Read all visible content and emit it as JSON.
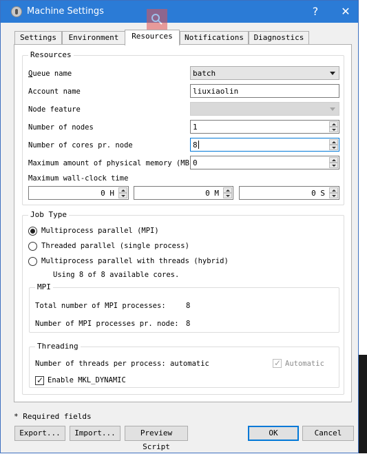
{
  "window": {
    "title": "Machine Settings",
    "help_button": "?",
    "close_button": "✕"
  },
  "tabs": [
    {
      "label": "Settings"
    },
    {
      "label": "Environment"
    },
    {
      "label": "Resources",
      "active": true
    },
    {
      "label": "Notifications"
    },
    {
      "label": "Diagnostics"
    }
  ],
  "resources": {
    "group_title": "Resources",
    "queue_name": {
      "label": "Queue name",
      "value": "batch"
    },
    "account_name": {
      "label": "Account name",
      "value": "liuxiaolin"
    },
    "node_feature": {
      "label": "Node feature",
      "value": ""
    },
    "number_of_nodes": {
      "label": "Number of nodes",
      "value": "1"
    },
    "cores_per_node": {
      "label": "Number of cores pr. node",
      "value": "8"
    },
    "max_memory": {
      "label": "Maximum amount of physical memory (MB)",
      "value": "0"
    },
    "max_wall_clock": {
      "label": "Maximum wall-clock time",
      "hours": "0 H",
      "minutes": "0 M",
      "seconds": "0 S"
    }
  },
  "job_type": {
    "group_title": "Job Type",
    "options": [
      {
        "label": "Multiprocess parallel (MPI)",
        "checked": true
      },
      {
        "label": "Threaded parallel (single process)",
        "checked": false
      },
      {
        "label": "Multiprocess parallel with threads (hybrid)",
        "checked": false
      }
    ],
    "cores_note": "Using 8 of 8 available cores.",
    "mpi": {
      "title": "MPI",
      "total_label": "Total number of MPI processes:",
      "total_value": "8",
      "per_node_label": "Number of MPI processes pr. node:",
      "per_node_value": "8"
    },
    "threading": {
      "title": "Threading",
      "threads_label": "Number of threads per process: automatic",
      "automatic_label": "Automatic",
      "automatic_checked": true,
      "mkl_label": "Enable MKL_DYNAMIC",
      "mkl_checked": true
    }
  },
  "footer": {
    "required_note": "* Required fields",
    "export_label": "Export...",
    "import_label": "Import...",
    "preview_label": "Preview Script",
    "ok_label": "OK",
    "cancel_label": "Cancel"
  },
  "icons": {
    "app": "app-gear-icon",
    "search_overlay": "search-icon",
    "spin": "spin-arrows-icon"
  },
  "colors": {
    "titlebar": "#2b7bd6",
    "focus_border": "#0078d7",
    "panel_bg": "#f0f0f0"
  }
}
